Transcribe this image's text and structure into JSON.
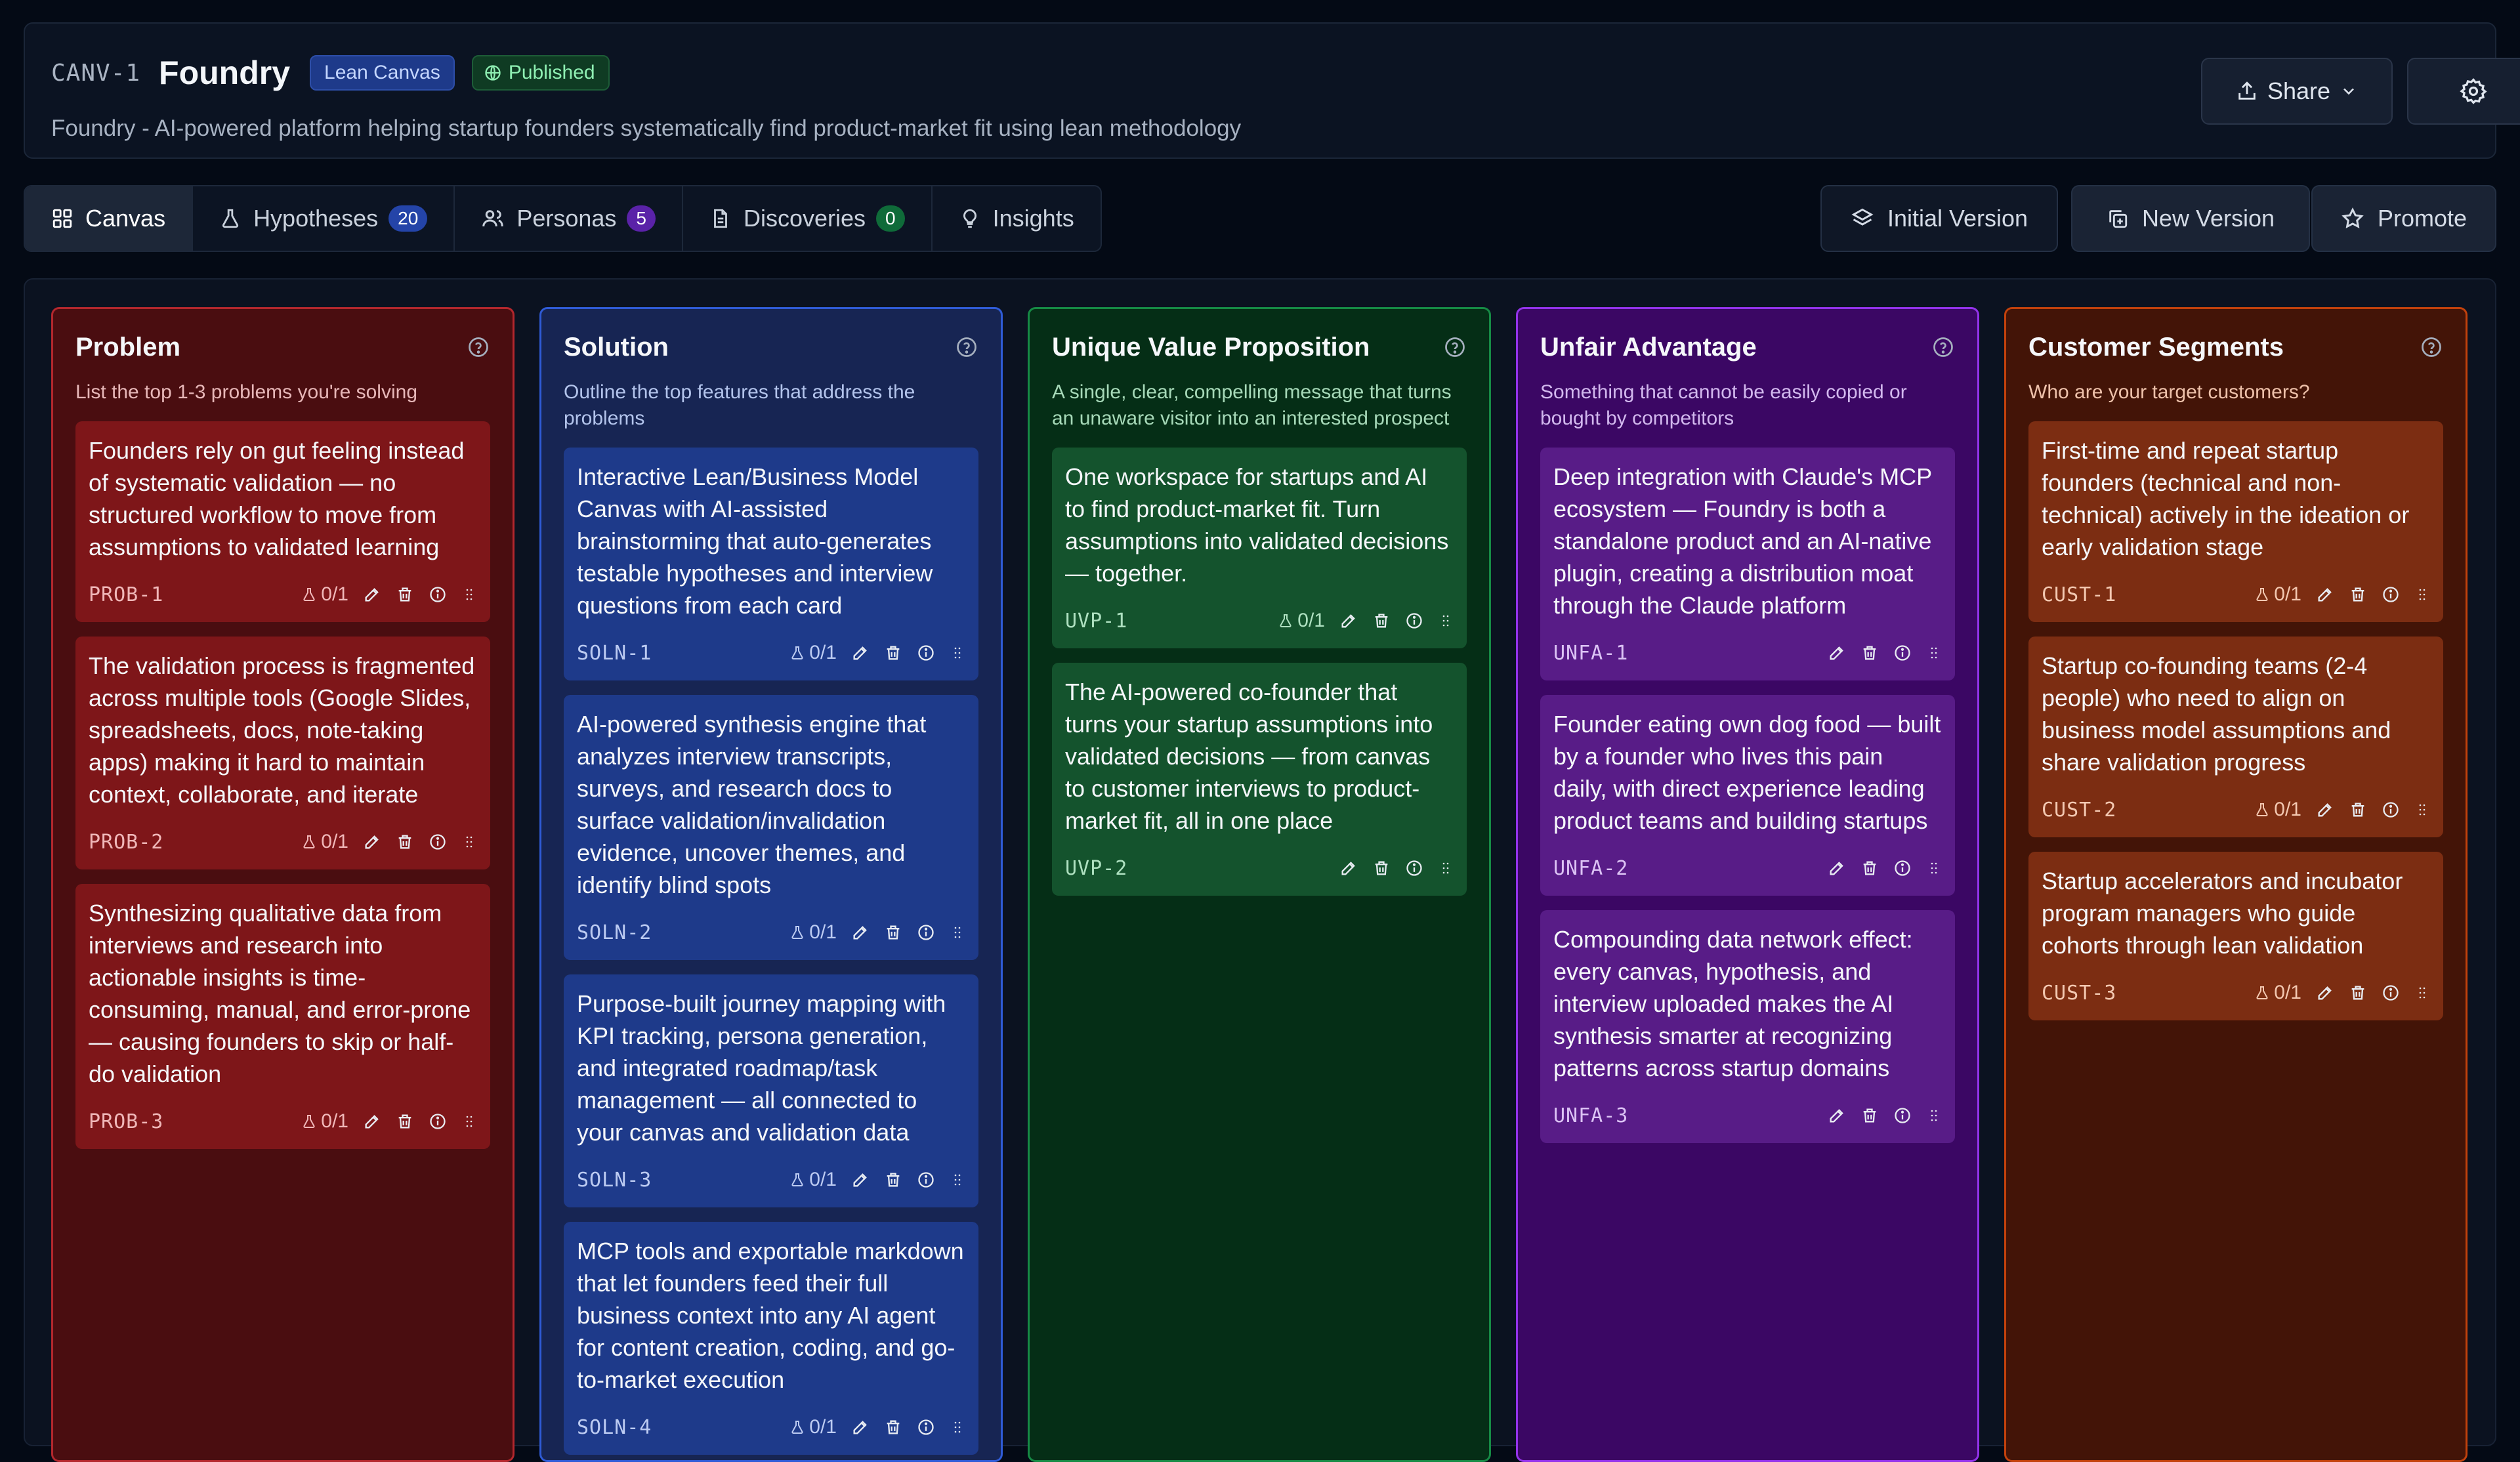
{
  "header": {
    "code": "CANV-1",
    "title": "Foundry",
    "type_badge": "Lean Canvas",
    "status_badge": "Published",
    "description": "Foundry - AI-powered platform helping startup founders systematically find product-market fit using lean methodology",
    "share_label": "Share"
  },
  "tabs": [
    {
      "label": "Canvas",
      "count": null
    },
    {
      "label": "Hypotheses",
      "count": "20"
    },
    {
      "label": "Personas",
      "count": "5"
    },
    {
      "label": "Discoveries",
      "count": "0"
    },
    {
      "label": "Insights",
      "count": null
    }
  ],
  "version_buttons": {
    "initial": "Initial Version",
    "new": "New Version",
    "promote": "Promote"
  },
  "columns": [
    {
      "title": "Problem",
      "description": "List the top 1-3 problems you're solving",
      "cards": [
        {
          "text": "Founders rely on gut feeling instead of systematic validation — no structured workflow to move from assumptions to validated learning",
          "id": "PROB-1",
          "votes": "0/1"
        },
        {
          "text": "The validation process is fragmented across multiple tools (Google Slides, spreadsheets, docs, note-taking apps) making it hard to maintain context, collaborate, and iterate",
          "id": "PROB-2",
          "votes": "0/1"
        },
        {
          "text": "Synthesizing qualitative data from interviews and research into actionable insights is time-consuming, manual, and error-prone — causing founders to skip or half-do validation",
          "id": "PROB-3",
          "votes": "0/1"
        }
      ]
    },
    {
      "title": "Solution",
      "description": "Outline the top features that address the problems",
      "cards": [
        {
          "text": "Interactive Lean/Business Model Canvas with AI-assisted brainstorming that auto-generates testable hypotheses and interview questions from each card",
          "id": "SOLN-1",
          "votes": "0/1"
        },
        {
          "text": "AI-powered synthesis engine that analyzes interview transcripts, surveys, and research docs to surface validation/invalidation evidence, uncover themes, and identify blind spots",
          "id": "SOLN-2",
          "votes": "0/1"
        },
        {
          "text": "Purpose-built journey mapping with KPI tracking, persona generation, and integrated roadmap/task management — all connected to your canvas and validation data",
          "id": "SOLN-3",
          "votes": "0/1"
        },
        {
          "text": "MCP tools and exportable markdown that let founders feed their full business context into any AI agent for content creation, coding, and go-to-market execution",
          "id": "SOLN-4",
          "votes": "0/1"
        }
      ]
    },
    {
      "title": "Unique Value Proposition",
      "description": "A single, clear, compelling message that turns an unaware visitor into an interested prospect",
      "cards": [
        {
          "text": "One workspace for startups and AI to find product-market fit. Turn assumptions into validated decisions — together.",
          "id": "UVP-1",
          "votes": "0/1"
        },
        {
          "text": "The AI-powered co-founder that turns your startup assumptions into validated decisions — from canvas to customer interviews to product-market fit, all in one place",
          "id": "UVP-2",
          "votes": null
        }
      ]
    },
    {
      "title": "Unfair Advantage",
      "description": "Something that cannot be easily copied or bought by competitors",
      "cards": [
        {
          "text": "Deep integration with Claude's MCP ecosystem — Foundry is both a standalone product and an AI-native plugin, creating a distribution moat through the Claude platform",
          "id": "UNFA-1",
          "votes": null
        },
        {
          "text": "Founder eating own dog food — built by a founder who lives this pain daily, with direct experience leading product teams and building startups",
          "id": "UNFA-2",
          "votes": null
        },
        {
          "text": "Compounding data network effect: every canvas, hypothesis, and interview uploaded makes the AI synthesis smarter at recognizing patterns across startup domains",
          "id": "UNFA-3",
          "votes": null
        }
      ]
    },
    {
      "title": "Customer Segments",
      "description": "Who are your target customers?",
      "cards": [
        {
          "text": "First-time and repeat startup founders (technical and non-technical) actively in the ideation or early validation stage",
          "id": "CUST-1",
          "votes": "0/1"
        },
        {
          "text": "Startup co-founding teams (2-4 people) who need to align on business model assumptions and share validation progress",
          "id": "CUST-2",
          "votes": "0/1"
        },
        {
          "text": "Startup accelerators and incubator program managers who guide cohorts through lean validation",
          "id": "CUST-3",
          "votes": "0/1"
        }
      ]
    }
  ],
  "colors": {
    "problem": "#7e1619",
    "solution": "#1e3a8a",
    "uvp": "#14532d",
    "unfair_advantage": "#581c87",
    "customer_segments": "#7c2d12"
  }
}
